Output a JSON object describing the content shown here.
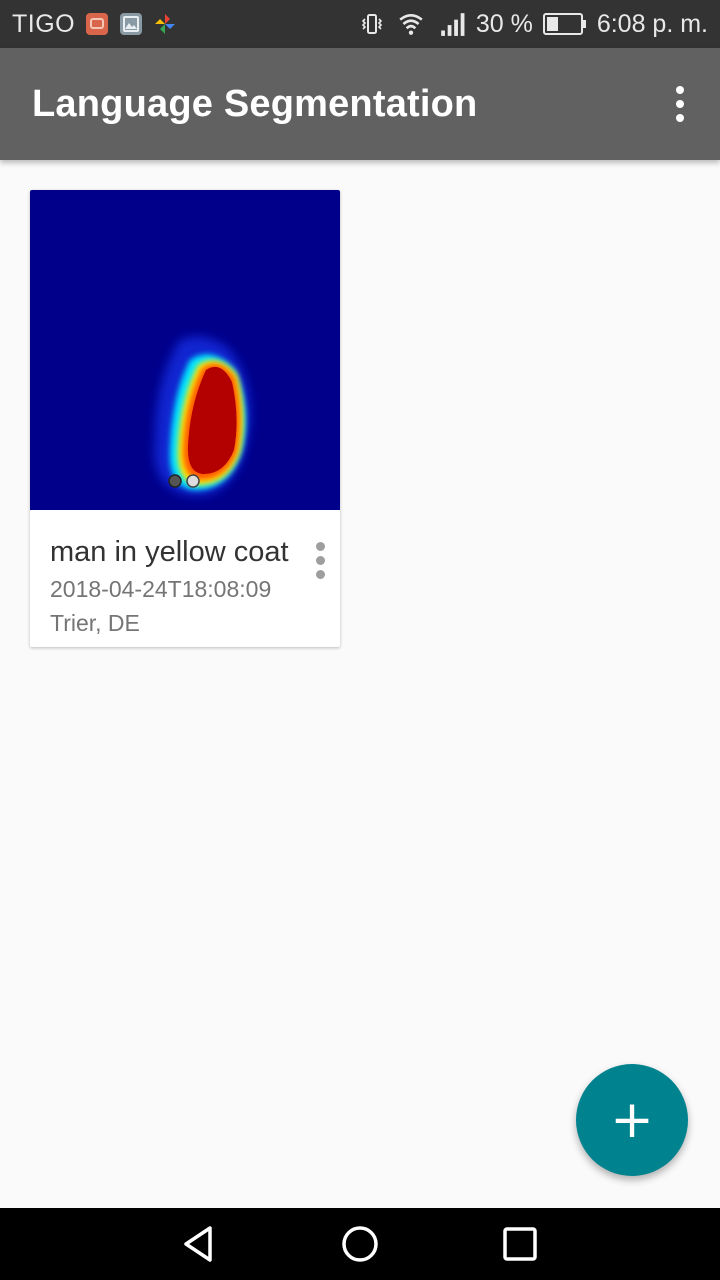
{
  "status_bar": {
    "carrier": "TIGO",
    "battery": "30 %",
    "time": "6:08 p. m.",
    "icons": [
      "notification-app-icon",
      "gallery-icon",
      "pinwheel-icon",
      "vibrate-icon",
      "wifi-icon",
      "signal-icon",
      "battery-icon"
    ]
  },
  "app_bar": {
    "title": "Language Segmentation",
    "menu_icon": "more-vert-icon"
  },
  "cards": [
    {
      "title": "man in yellow coat",
      "date": "2018-04-24T18:08:09",
      "location": "Trier, DE",
      "image": "heatmap-segmentation-thumbnail",
      "menu_icon": "more-vert-icon"
    }
  ],
  "fab": {
    "label": "+",
    "icon": "add-icon",
    "color": "#00838f"
  },
  "nav_bar": {
    "icons": [
      "back-icon",
      "home-icon",
      "recents-icon"
    ]
  },
  "colors": {
    "app_bar": "#616161",
    "status_bar": "#333333",
    "background": "#fafafa",
    "heatmap_background": "#00008b"
  }
}
